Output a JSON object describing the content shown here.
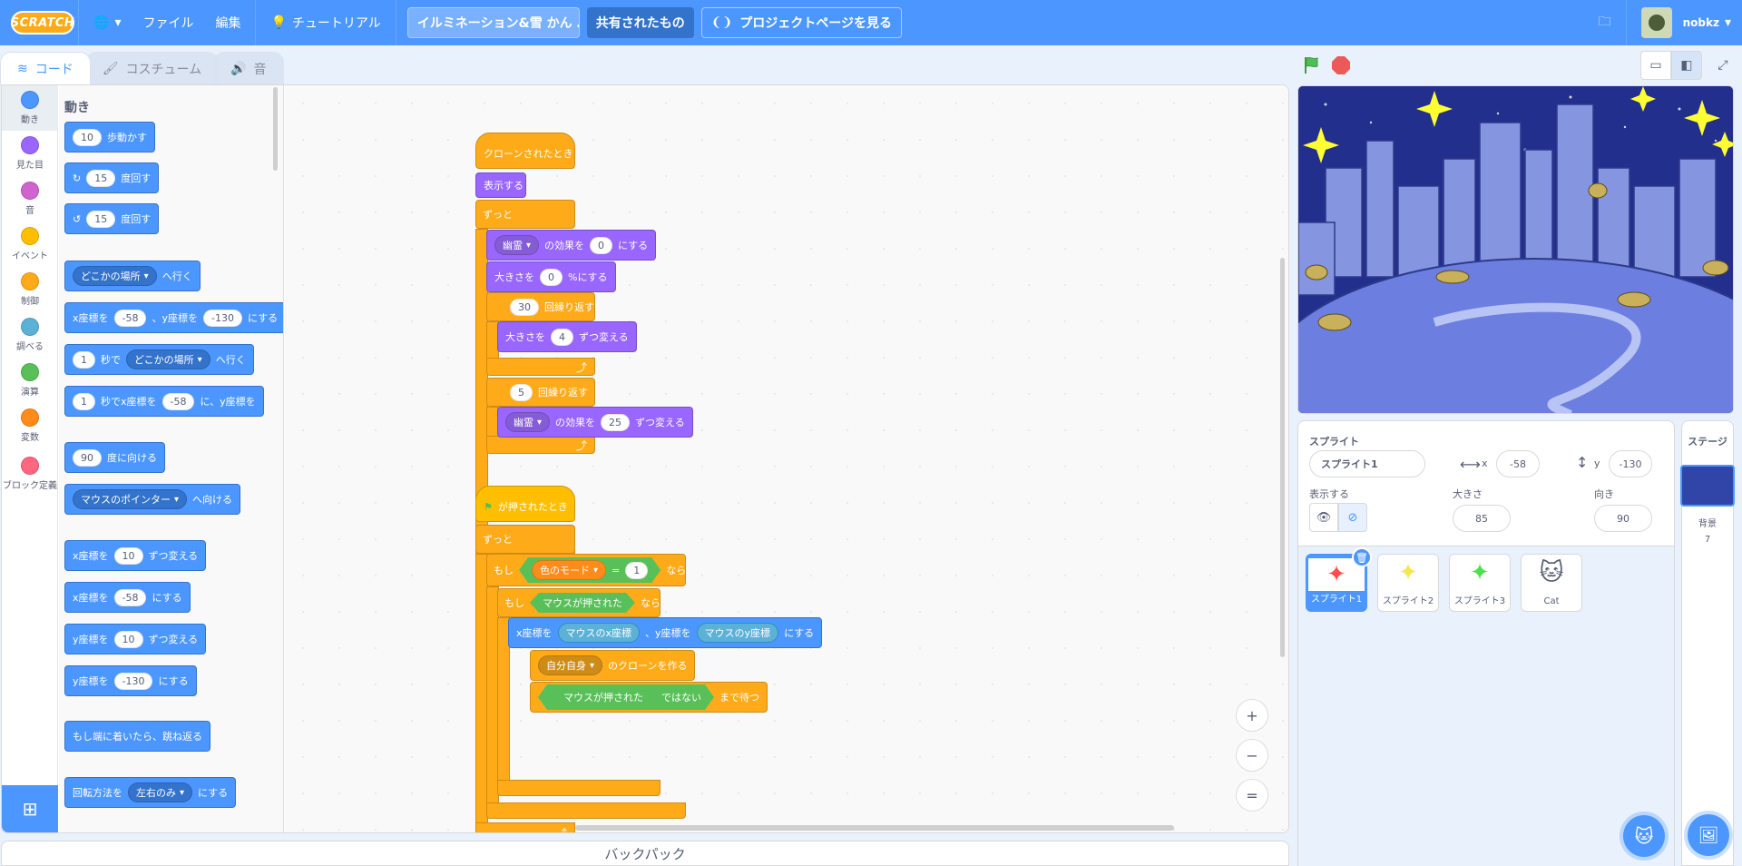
{
  "menu": {
    "logo": "SCRATCH",
    "file": "ファイル",
    "edit": "編集",
    "tutorials": "チュートリアル",
    "project_title": "イルミネーション&雪 かん …",
    "shared": "共有されたもの",
    "project_page": "プロジェクトページを見る",
    "username": "nobkz"
  },
  "tabs": {
    "code": "コード",
    "costumes": "コスチューム",
    "sounds": "音"
  },
  "categories": [
    {
      "label": "動き",
      "color": "#4c97ff"
    },
    {
      "label": "見た目",
      "color": "#9966ff"
    },
    {
      "label": "音",
      "color": "#cf63cf"
    },
    {
      "label": "イベント",
      "color": "#ffbf00"
    },
    {
      "label": "制御",
      "color": "#ffab19"
    },
    {
      "label": "調べる",
      "color": "#5cb1d6"
    },
    {
      "label": "演算",
      "color": "#59c059"
    },
    {
      "label": "変数",
      "color": "#ff8c1a"
    },
    {
      "label": "ブロック定義",
      "color": "#ff6680"
    }
  ],
  "flyout": {
    "title": "動き",
    "move": {
      "n": "10",
      "t": "歩動かす"
    },
    "turn_r": {
      "n": "15",
      "t": "度回す"
    },
    "turn_l": {
      "n": "15",
      "t": "度回す"
    },
    "goto": {
      "d": "どこかの場所",
      "t": "へ行く"
    },
    "gotoxy": {
      "a": "x座標を",
      "x": "-58",
      "b": "、y座標を",
      "y": "-130",
      "c": "にする"
    },
    "glide": {
      "n": "1",
      "a": "秒で",
      "d": "どこかの場所",
      "b": "へ行く"
    },
    "glidexy": {
      "n": "1",
      "a": "秒でx座標を",
      "x": "-58",
      "b": "に、y座標を"
    },
    "point": {
      "n": "90",
      "t": "度に向ける"
    },
    "pointto": {
      "d": "マウスのポインター",
      "t": "へ向ける"
    },
    "changex": {
      "a": "x座標を",
      "n": "10",
      "b": "ずつ変える"
    },
    "setx": {
      "a": "x座標を",
      "n": "-58",
      "b": "にする"
    },
    "changey": {
      "a": "y座標を",
      "n": "10",
      "b": "ずつ変える"
    },
    "sety": {
      "a": "y座標を",
      "n": "-130",
      "b": "にする"
    },
    "bounce": "もし端に着いたら、跳ね返る",
    "rotstyle": {
      "a": "回転方法を",
      "d": "左右のみ",
      "b": "にする"
    }
  },
  "script1": {
    "hat": "クローンされたとき",
    "show": "表示する",
    "forever": "ずっと",
    "effect_set": {
      "d": "幽霊",
      "a": "の効果を",
      "n": "0",
      "b": "にする"
    },
    "size_set": {
      "a": "大きさを",
      "n": "0",
      "b": "%にする"
    },
    "repeat1": {
      "n": "30",
      "t": "回繰り返す"
    },
    "size_change": {
      "a": "大きさを",
      "n": "4",
      "b": "ずつ変える"
    },
    "repeat2": {
      "n": "5",
      "t": "回繰り返す"
    },
    "effect_change": {
      "d": "幽霊",
      "a": "の効果を",
      "n": "25",
      "b": "ずつ変える"
    }
  },
  "script2": {
    "hat": "が押されたとき",
    "forever": "ずっと",
    "if1": "もし",
    "var": "色のモード",
    "eq": "=",
    "eqval": "1",
    "then1": "なら",
    "if2": "もし",
    "mouse_down": "マウスが押された",
    "then2": "なら",
    "gotoxy": {
      "a": "x座標を",
      "x": "マウスのx座標",
      "b": "、y座標を",
      "y": "マウスのy座標",
      "c": "にする"
    },
    "clone": {
      "d": "自分自身",
      "t": "のクローンを作る"
    },
    "wait": {
      "r": "マウスが押された",
      "not": "ではない",
      "t": "まで待つ"
    }
  },
  "zoom": {
    "in": "+",
    "out": "−",
    "reset": "="
  },
  "backpack": "バックパック",
  "sprite_info": {
    "label": "スプライト",
    "name": "スプライト1",
    "x_label": "x",
    "x": "-58",
    "y_label": "y",
    "y": "-130",
    "show_label": "表示する",
    "size_label": "大きさ",
    "size": "85",
    "direction_label": "向き",
    "direction": "90"
  },
  "sprites": [
    {
      "name": "スプライト1",
      "glyph": "✦",
      "color": "#ff4d4d"
    },
    {
      "name": "スプライト2",
      "glyph": "✦",
      "color": "#f5e84a"
    },
    {
      "name": "スプライト3",
      "glyph": "✦",
      "color": "#4ddf4d"
    },
    {
      "name": "Cat",
      "glyph": "🐱",
      "color": "#ffab19"
    }
  ],
  "stage_pane": {
    "title": "ステージ",
    "backdrops_label": "背景",
    "backdrops_count": "7"
  }
}
